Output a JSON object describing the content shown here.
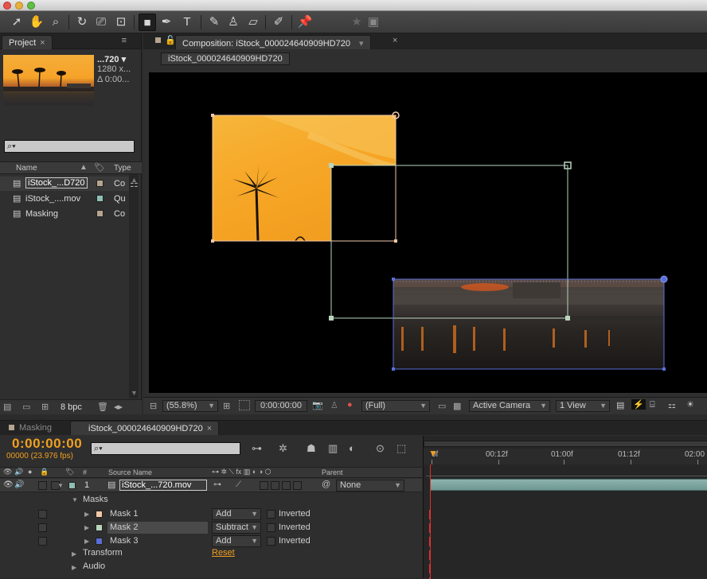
{
  "project": {
    "tab": "Project",
    "close": "×",
    "menu": "≡",
    "thumb_name": "...720 ▾",
    "thumb_res": "1280 x...",
    "thumb_dur": "Δ 0:00...",
    "search_icon": "⌕▾",
    "columns": {
      "name": "Name",
      "type": "Type"
    },
    "items": [
      {
        "name": "iStock_...D720",
        "type": "Co",
        "color": "#b5a58f",
        "icon": "composition-icon"
      },
      {
        "name": "iStock_....mov",
        "type": "Qu",
        "color": "#8fbfb3",
        "icon": "footage-icon"
      },
      {
        "name": "Masking",
        "type": "Co",
        "color": "#b5a58f",
        "icon": "composition-icon"
      }
    ],
    "bpc": "8 bpc"
  },
  "composition": {
    "tab": "Composition: iStock_000024640909HD720",
    "subtab": "iStock_000024640909HD720",
    "zoom": "(55.8%)",
    "timecode": "0:00:00:00",
    "resolution": "(Full)",
    "camera": "Active Camera",
    "views": "1 View"
  },
  "timeline": {
    "tabs": [
      {
        "label": "Masking",
        "active": false
      },
      {
        "label": "iStock_000024640909HD720",
        "active": true
      }
    ],
    "current_time": "0:00:00:00",
    "frames": "00000 (23.976 fps)",
    "search_icon": "⌕▾",
    "columns": {
      "num": "#",
      "source": "Source Name",
      "parent": "Parent"
    },
    "ruler": [
      "0f",
      "00:12f",
      "01:00f",
      "01:12f",
      "02:00"
    ],
    "layer": {
      "num": "1",
      "name": "iStock_...720.mov",
      "parent": "None"
    },
    "masks_label": "Masks",
    "masks": [
      {
        "name": "Mask 1",
        "mode": "Add",
        "color": "#f2c8a8",
        "inverted": "Inverted"
      },
      {
        "name": "Mask 2",
        "mode": "Subtract",
        "color": "#b9d6bd",
        "inverted": "Inverted"
      },
      {
        "name": "Mask 3",
        "mode": "Add",
        "color": "#5a6fd6",
        "inverted": "Inverted"
      }
    ],
    "transform_label": "Transform",
    "transform_reset": "Reset",
    "audio_label": "Audio"
  },
  "colors": {
    "accent": "#f0a020",
    "panel": "#2f2f2f",
    "dark": "#232323",
    "mask1": "#f2c8a8",
    "mask2": "#b9d6bd",
    "mask3": "#5a6fd6"
  }
}
